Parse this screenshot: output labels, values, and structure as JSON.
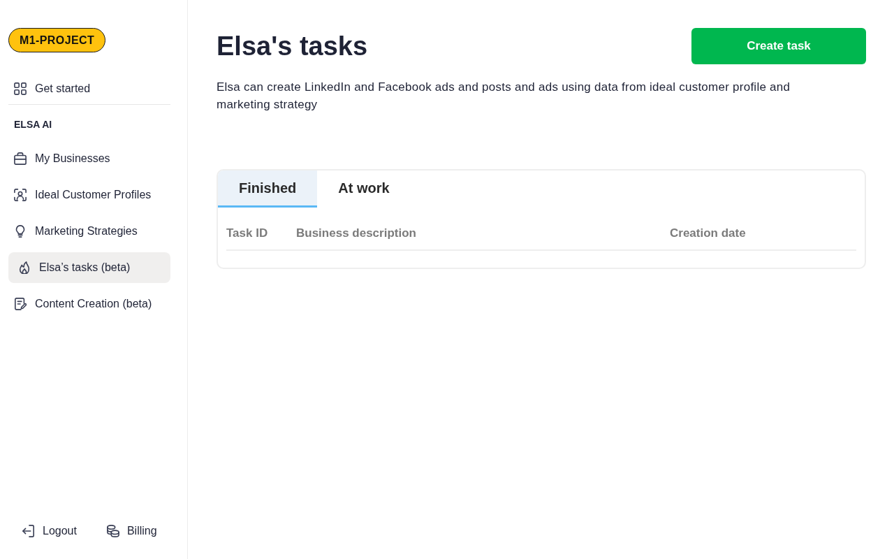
{
  "sidebar": {
    "logo": "M1-PROJECT",
    "top_items": [
      {
        "label": "Get started",
        "selected": false
      }
    ],
    "section_title": "ELSA AI",
    "items": [
      {
        "label": "My Businesses",
        "selected": false
      },
      {
        "label": "Ideal Customer Profiles",
        "selected": false
      },
      {
        "label": "Marketing Strategies",
        "selected": false
      },
      {
        "label": "Elsa’s tasks (beta)",
        "selected": true
      },
      {
        "label": "Content Creation (beta)",
        "selected": false
      }
    ],
    "footer_links": [
      "Logout",
      "Billing"
    ]
  },
  "main": {
    "title": "Elsa's tasks",
    "create_button": "Create task",
    "description": "Elsa can create LinkedIn and Facebook ads and posts and ads using data from ideal customer profile and marketing strategy",
    "tabs": [
      {
        "label": "Finished",
        "selected": true
      },
      {
        "label": "At work",
        "selected": false
      }
    ],
    "table": {
      "columns": [
        "Task ID",
        "Business description",
        "Creation date"
      ]
    }
  }
}
